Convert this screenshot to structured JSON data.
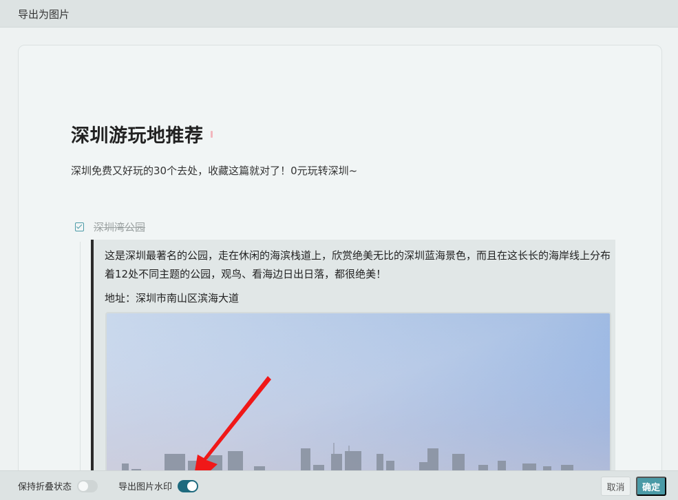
{
  "dialog": {
    "title": "导出为图片"
  },
  "document": {
    "title": "深圳游玩地推荐",
    "subtitle": "深圳免费又好玩的30个去处，收藏这篇就对了！0元玩转深圳~",
    "todo_item": {
      "label": "深圳湾公园",
      "checked": true
    },
    "quote": {
      "paragraph": "这是深圳最著名的公园，走在休闲的海滨栈道上，欣赏绝美无比的深圳蓝海景色，而且在这长长的海岸线上分布着12处不同主题的公园，观鸟、看海边日出日落，都很绝美！",
      "address": "地址：深圳市南山区滨海大道"
    }
  },
  "footer": {
    "keep_fold_label": "保持折叠状态",
    "keep_fold_on": false,
    "watermark_label": "导出图片水印",
    "watermark_on": true,
    "cancel_label": "取消",
    "ok_label": "确定"
  },
  "colors": {
    "accent": "#4a9aa6",
    "toggle_on": "#1e6a7e",
    "annotation_arrow": "#f01818"
  },
  "icons": {
    "todo_checkbox": "checkbox-checked-icon",
    "annotation": "red-arrow-icon"
  }
}
